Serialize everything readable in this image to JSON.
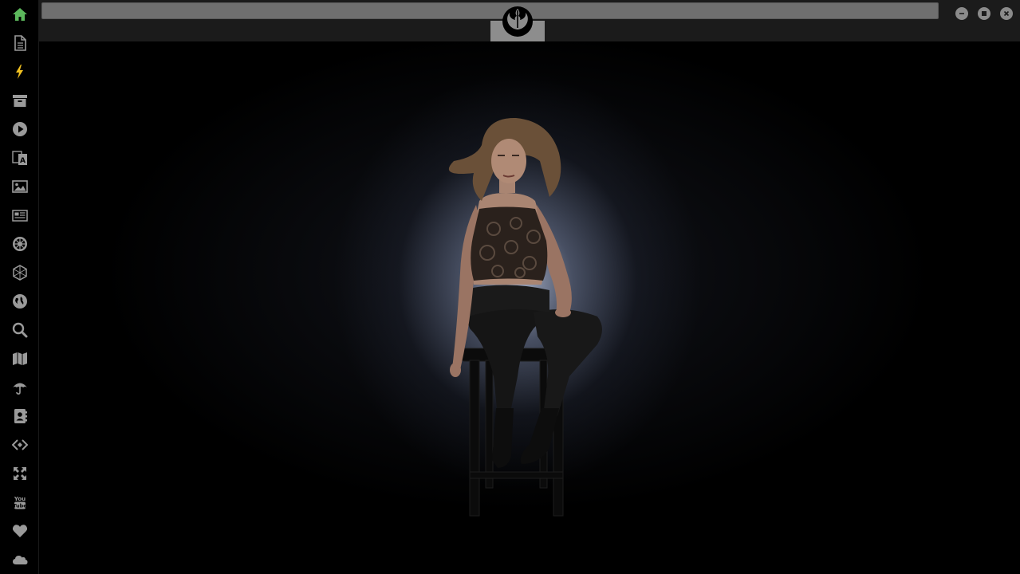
{
  "window": {
    "address_value": "",
    "buttons": [
      "minimize",
      "maximize",
      "close"
    ]
  },
  "sidebar": {
    "items": [
      {
        "icon": "home-icon",
        "color": "#5cb85c"
      },
      {
        "icon": "document-icon"
      },
      {
        "icon": "lightning-icon",
        "color": "#f0c020"
      },
      {
        "icon": "archive-icon"
      },
      {
        "icon": "play-circle-icon"
      },
      {
        "icon": "translate-icon"
      },
      {
        "icon": "image-icon"
      },
      {
        "icon": "newspaper-icon"
      },
      {
        "icon": "galactic-empire-icon"
      },
      {
        "icon": "hexagon-network-icon"
      },
      {
        "icon": "globe-icon"
      },
      {
        "icon": "search-icon"
      },
      {
        "icon": "map-icon"
      },
      {
        "icon": "umbrella-icon"
      },
      {
        "icon": "contacts-icon"
      },
      {
        "icon": "code-icon"
      },
      {
        "icon": "expand-icon"
      },
      {
        "icon": "youtube-icon"
      },
      {
        "icon": "heart-icon"
      },
      {
        "icon": "cloud-icon"
      }
    ]
  },
  "header": {
    "logo": "rebel-alliance-icon"
  },
  "colors": {
    "accent_green": "#5cb85c",
    "accent_yellow": "#f0c020",
    "icon_gray": "#9a9a9a"
  }
}
